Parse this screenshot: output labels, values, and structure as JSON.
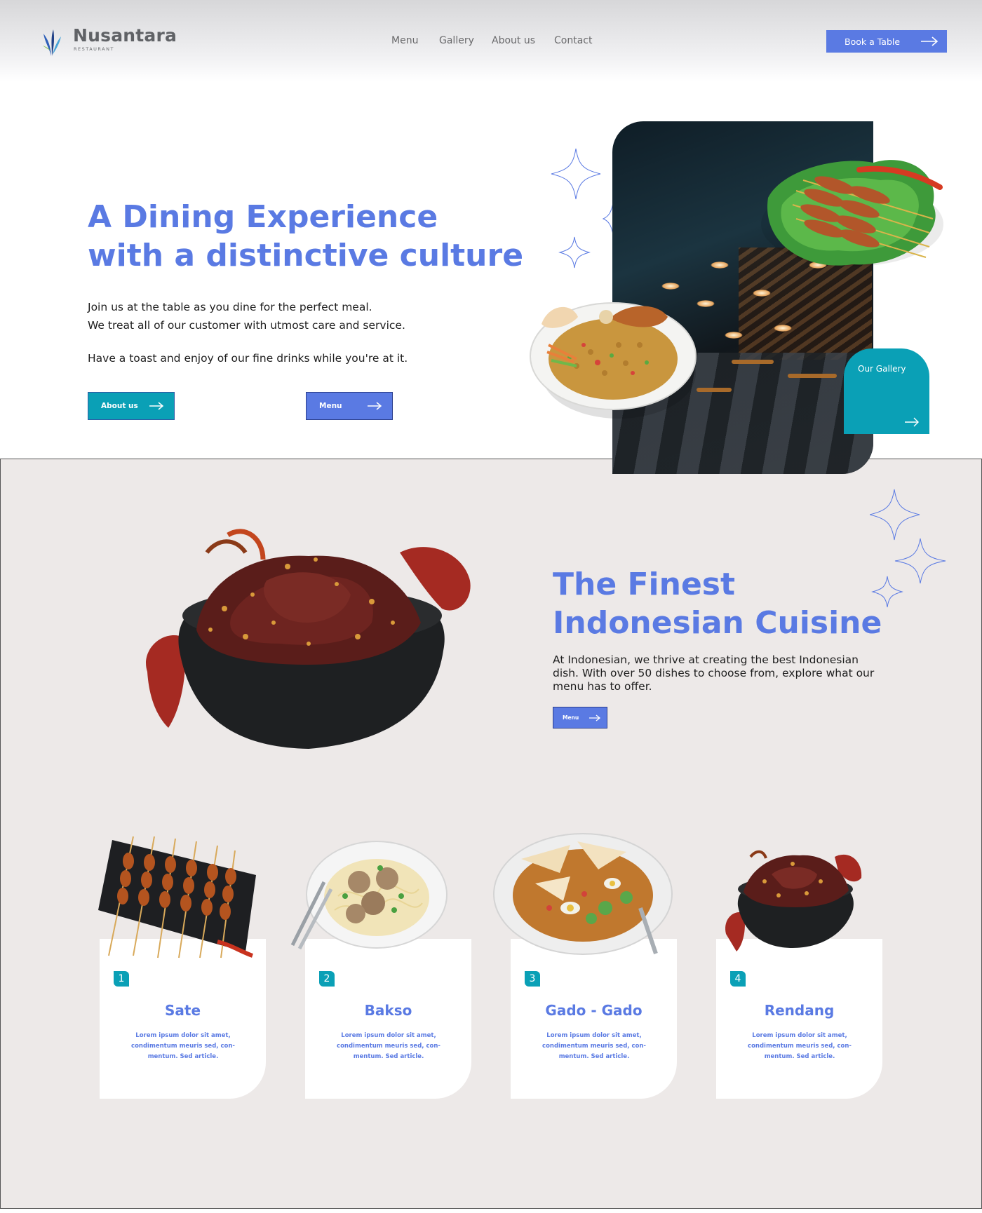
{
  "brand": {
    "name": "Nusantara",
    "subtitle": "RESTAURANT"
  },
  "nav": {
    "items": [
      {
        "label": "Menu"
      },
      {
        "label": "Gallery"
      },
      {
        "label": "About us"
      },
      {
        "label": "Contact"
      }
    ],
    "cta_label": "Book a Table"
  },
  "hero": {
    "title_line1": "A Dining Experience",
    "title_line2": "with a distinctive culture",
    "text_line1": "Join us at the table as you dine for the perfect meal.",
    "text_line2": "We treat all of our customer with utmost care and service.",
    "text_line3": "Have a toast and enjoy of our fine drinks while you're at it.",
    "about_button": "About us",
    "menu_button": "Menu",
    "gallery_card_label": "Our Gallery"
  },
  "cuisine": {
    "title_line1": "The Finest",
    "title_line2": "Indonesian Cuisine",
    "text": "At Indonesian, we thrive at creating the best Indonesian dish. With over 50 dishes to choose from, explore what our menu has to offer.",
    "menu_button": "Menu"
  },
  "dishes": [
    {
      "number": "1",
      "name": "Sate",
      "description": "Lorem ipsum dolor sit amet, condimentum meuris sed, con-mentum. Sed article."
    },
    {
      "number": "2",
      "name": "Bakso",
      "description": "Lorem ipsum dolor sit amet, condimentum meuris sed, con-mentum. Sed article."
    },
    {
      "number": "3",
      "name": "Gado - Gado",
      "description": "Lorem ipsum dolor sit amet, condimentum meuris sed, con-mentum. Sed article."
    },
    {
      "number": "4",
      "name": "Rendang",
      "description": "Lorem ipsum dolor sit amet, condimentum meuris sed, con-mentum. Sed article."
    }
  ],
  "icons": {
    "logo": "leaf-logo-icon",
    "arrow": "arrow-right-icon",
    "sparkle": "sparkle-icon"
  },
  "colors": {
    "accent_blue": "#5a7ae3",
    "accent_teal": "#0aa0b6",
    "section_bg": "#ede9e8"
  }
}
